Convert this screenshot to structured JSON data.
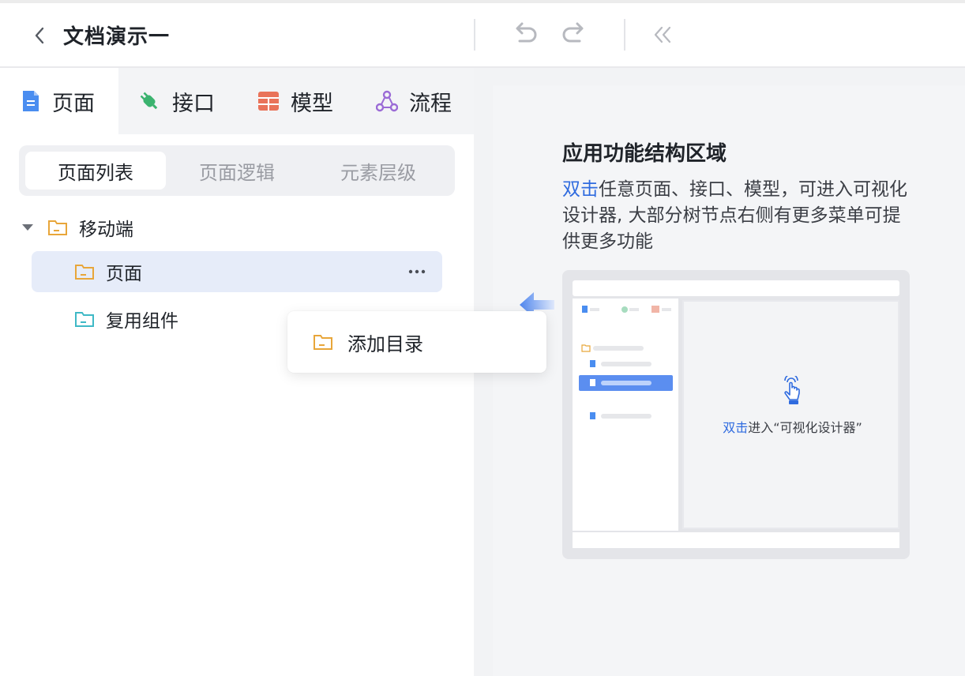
{
  "header": {
    "title": "文档演示一",
    "icons": {
      "back": "chevron-left-icon",
      "undo": "undo-icon",
      "redo": "redo-icon",
      "collapse": "double-chevron-left-icon"
    }
  },
  "tabs": [
    {
      "label": "页面",
      "icon": "page-doc-icon",
      "color": "#4a8df0",
      "active": true
    },
    {
      "label": "接口",
      "icon": "plug-icon",
      "color": "#3bb36f",
      "active": false
    },
    {
      "label": "模型",
      "icon": "table-icon",
      "color": "#e9735a",
      "active": false
    },
    {
      "label": "流程",
      "icon": "flow-icon",
      "color": "#9b6bd6",
      "active": false
    }
  ],
  "segments": [
    {
      "label": "页面列表",
      "active": true
    },
    {
      "label": "页面逻辑",
      "active": false
    },
    {
      "label": "元素层级",
      "active": false
    }
  ],
  "tree": [
    {
      "label": "移动端",
      "icon": "folder-icon",
      "expanded": true
    },
    {
      "label": "页面",
      "icon": "folder-icon",
      "selected": true
    },
    {
      "label": "复用组件",
      "icon": "folder-teal-icon"
    }
  ],
  "context_menu": {
    "items": [
      {
        "label": "添加目录",
        "icon": "folder-icon"
      }
    ]
  },
  "guide": {
    "title": "应用功能结构区域",
    "desc_highlight": "双击",
    "desc_rest": "任意页面、接口、模型，可进入可视化设计器, 大部分树节点右侧有更多菜单可提供更多功能",
    "illustration": {
      "caption_highlight": "双击",
      "caption_rest": "进入“可视化设计器”"
    }
  },
  "colors": {
    "accent": "#2f6bdf",
    "folder": "#e8a63a",
    "folder_teal": "#3fb9c6",
    "selected_row": "#e6ecf9"
  }
}
